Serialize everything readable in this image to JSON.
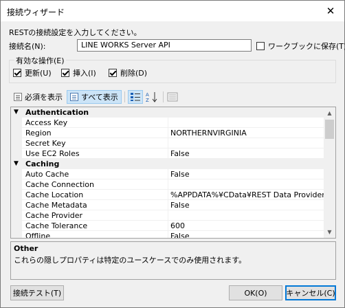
{
  "window": {
    "title": "接続ウィザード",
    "close": "✕"
  },
  "intro": "RESTの接続設定を入力してください。",
  "connection": {
    "label": "接続名(N):",
    "value": "LINE WORKS Server API",
    "save_label": "ワークブックに保存(T)",
    "save_checked": false
  },
  "operations": {
    "title": "有効な操作(E)",
    "items": [
      {
        "label": "更新(U)",
        "checked": true
      },
      {
        "label": "挿入(I)",
        "checked": true
      },
      {
        "label": "削除(D)",
        "checked": true
      }
    ]
  },
  "toolbar": {
    "required_label": "必須を表示",
    "all_label": "すべて表示"
  },
  "grid": {
    "rows": [
      {
        "kind": "category",
        "name": "Authentication",
        "toggle": "▼"
      },
      {
        "kind": "prop",
        "name": "Access Key",
        "value": ""
      },
      {
        "kind": "prop",
        "name": "Region",
        "value": "NORTHERNVIRGINIA"
      },
      {
        "kind": "prop",
        "name": "Secret Key",
        "value": ""
      },
      {
        "kind": "prop",
        "name": "Use EC2 Roles",
        "value": "False"
      },
      {
        "kind": "category",
        "name": "Caching",
        "toggle": "▼"
      },
      {
        "kind": "prop",
        "name": "Auto Cache",
        "value": "False"
      },
      {
        "kind": "prop",
        "name": "Cache Connection",
        "value": ""
      },
      {
        "kind": "prop",
        "name": "Cache Location",
        "value": "%APPDATA%¥CData¥REST Data Provider"
      },
      {
        "kind": "prop",
        "name": "Cache Metadata",
        "value": "False"
      },
      {
        "kind": "prop",
        "name": "Cache Provider",
        "value": ""
      },
      {
        "kind": "prop",
        "name": "Cache Tolerance",
        "value": "600"
      },
      {
        "kind": "prop",
        "name": "Offline",
        "value": "False"
      }
    ]
  },
  "description": {
    "title": "Other",
    "text": "これらの隠しプロパティは特定のユースケースでのみ使用されます。"
  },
  "buttons": {
    "test": "接続テスト(T)",
    "ok": "OK(O)",
    "cancel": "キャンセル(C)"
  }
}
